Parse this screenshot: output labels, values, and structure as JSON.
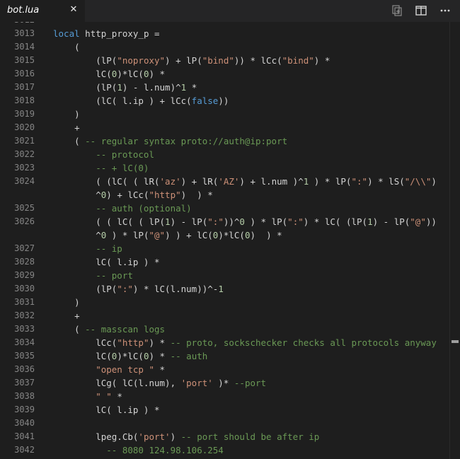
{
  "tab": {
    "title": "bot.lua",
    "close": "✕"
  },
  "actions": [
    "open-changes-icon",
    "split-editor-icon",
    "more-actions-icon"
  ],
  "lines": [
    {
      "n": "3012",
      "tokens": []
    },
    {
      "n": "3013",
      "tokens": [
        [
          "kw",
          "local"
        ],
        [
          "id",
          " http_proxy_p ="
        ]
      ]
    },
    {
      "n": "3014",
      "tokens": [
        [
          "id",
          "    ("
        ]
      ]
    },
    {
      "n": "3015",
      "tokens": [
        [
          "id",
          "        (lP("
        ],
        [
          "str",
          "\"noproxy\""
        ],
        [
          "id",
          ") + lP("
        ],
        [
          "str",
          "\"bind\""
        ],
        [
          "id",
          ")) * lCc("
        ],
        [
          "str",
          "\"bind\""
        ],
        [
          "id",
          ") *"
        ]
      ]
    },
    {
      "n": "3016",
      "tokens": [
        [
          "id",
          "        lC("
        ],
        [
          "num",
          "0"
        ],
        [
          "id",
          ")*lC("
        ],
        [
          "num",
          "0"
        ],
        [
          "id",
          ") *"
        ]
      ]
    },
    {
      "n": "3017",
      "tokens": [
        [
          "id",
          "        (lP("
        ],
        [
          "num",
          "1"
        ],
        [
          "id",
          ") - l.num)^"
        ],
        [
          "num",
          "1"
        ],
        [
          "id",
          " *"
        ]
      ]
    },
    {
      "n": "3018",
      "tokens": [
        [
          "id",
          "        (lC( l.ip ) + lCc("
        ],
        [
          "bool",
          "false"
        ],
        [
          "id",
          "))"
        ]
      ]
    },
    {
      "n": "3019",
      "tokens": [
        [
          "id",
          "    )"
        ]
      ]
    },
    {
      "n": "3020",
      "tokens": [
        [
          "id",
          "    +"
        ]
      ]
    },
    {
      "n": "3021",
      "tokens": [
        [
          "id",
          "    ( "
        ],
        [
          "cmt",
          "-- regular syntax proto://auth@ip:port"
        ]
      ]
    },
    {
      "n": "3022",
      "tokens": [
        [
          "cmt",
          "        -- protocol"
        ]
      ]
    },
    {
      "n": "3023",
      "tokens": [
        [
          "cmt",
          "        -- + lC(0)"
        ]
      ]
    },
    {
      "n": "3024",
      "tokens": [
        [
          "id",
          "        ( (lC( ( lR("
        ],
        [
          "str",
          "'az'"
        ],
        [
          "id",
          ") + lR("
        ],
        [
          "str",
          "'AZ'"
        ],
        [
          "id",
          ") + l.num )^"
        ],
        [
          "num",
          "1"
        ],
        [
          "id",
          " ) * lP("
        ],
        [
          "str",
          "\":\""
        ],
        [
          "id",
          ") * lS("
        ],
        [
          "str",
          "\"/\\\\\""
        ],
        [
          "id",
          ")"
        ]
      ]
    },
    {
      "n": "",
      "tokens": [
        [
          "id",
          "        ^"
        ],
        [
          "num",
          "0"
        ],
        [
          "id",
          ") + lCc("
        ],
        [
          "str",
          "\"http\""
        ],
        [
          "id",
          ")  ) *"
        ]
      ]
    },
    {
      "n": "3025",
      "tokens": [
        [
          "cmt",
          "        -- auth (optional)"
        ]
      ]
    },
    {
      "n": "3026",
      "tokens": [
        [
          "id",
          "        ( ( lC( ( lP("
        ],
        [
          "num",
          "1"
        ],
        [
          "id",
          ") - lP("
        ],
        [
          "str",
          "\":\""
        ],
        [
          "id",
          "))^"
        ],
        [
          "num",
          "0"
        ],
        [
          "id",
          " ) * lP("
        ],
        [
          "str",
          "\":\""
        ],
        [
          "id",
          ") * lC( (lP("
        ],
        [
          "num",
          "1"
        ],
        [
          "id",
          ") - lP("
        ],
        [
          "str",
          "\"@\""
        ],
        [
          "id",
          "))"
        ]
      ]
    },
    {
      "n": "",
      "tokens": [
        [
          "id",
          "        ^"
        ],
        [
          "num",
          "0"
        ],
        [
          "id",
          " ) * lP("
        ],
        [
          "str",
          "\"@\""
        ],
        [
          "id",
          ") ) + lC("
        ],
        [
          "num",
          "0"
        ],
        [
          "id",
          ")*lC("
        ],
        [
          "num",
          "0"
        ],
        [
          "id",
          ")  ) *"
        ]
      ]
    },
    {
      "n": "3027",
      "tokens": [
        [
          "cmt",
          "        -- ip"
        ]
      ]
    },
    {
      "n": "3028",
      "tokens": [
        [
          "id",
          "        lC( l.ip ) *"
        ]
      ]
    },
    {
      "n": "3029",
      "tokens": [
        [
          "cmt",
          "        -- port"
        ]
      ]
    },
    {
      "n": "3030",
      "tokens": [
        [
          "id",
          "        (lP("
        ],
        [
          "str",
          "\":\""
        ],
        [
          "id",
          ") * lC(l.num))^-"
        ],
        [
          "num",
          "1"
        ]
      ]
    },
    {
      "n": "3031",
      "tokens": [
        [
          "id",
          "    )"
        ]
      ]
    },
    {
      "n": "3032",
      "tokens": [
        [
          "id",
          "    +"
        ]
      ]
    },
    {
      "n": "3033",
      "tokens": [
        [
          "id",
          "    ( "
        ],
        [
          "cmt",
          "-- masscan logs"
        ]
      ]
    },
    {
      "n": "3034",
      "tokens": [
        [
          "id",
          "        lCc("
        ],
        [
          "str",
          "\"http\""
        ],
        [
          "id",
          ") * "
        ],
        [
          "cmt",
          "-- proto, sockschecker checks all protocols anyway"
        ]
      ]
    },
    {
      "n": "3035",
      "tokens": [
        [
          "id",
          "        lC("
        ],
        [
          "num",
          "0"
        ],
        [
          "id",
          ")*lC("
        ],
        [
          "num",
          "0"
        ],
        [
          "id",
          ") * "
        ],
        [
          "cmt",
          "-- auth"
        ]
      ]
    },
    {
      "n": "3036",
      "tokens": [
        [
          "str",
          "        \"open tcp \""
        ],
        [
          "id",
          " *"
        ]
      ]
    },
    {
      "n": "3037",
      "tokens": [
        [
          "id",
          "        lCg( lC(l.num), "
        ],
        [
          "str",
          "'port'"
        ],
        [
          "id",
          " )* "
        ],
        [
          "cmt",
          "--port"
        ]
      ]
    },
    {
      "n": "3038",
      "tokens": [
        [
          "str",
          "        \" \""
        ],
        [
          "id",
          " *"
        ]
      ]
    },
    {
      "n": "3039",
      "tokens": [
        [
          "id",
          "        lC( l.ip ) *"
        ]
      ]
    },
    {
      "n": "3040",
      "tokens": []
    },
    {
      "n": "3041",
      "tokens": [
        [
          "id",
          "        lpeg.Cb("
        ],
        [
          "str",
          "'port'"
        ],
        [
          "id",
          ") "
        ],
        [
          "cmt",
          "-- port should be after ip"
        ]
      ]
    },
    {
      "n": "3042",
      "tokens": [
        [
          "cmt",
          "          -- 8080 124.98.106.254"
        ]
      ]
    }
  ],
  "colors": {
    "background": "#1e1e1e",
    "keyword": "#569cd6",
    "string": "#ce9178",
    "number": "#b5cea8",
    "comment": "#6a9955",
    "text": "#d4d4d4",
    "line_number": "#858585"
  }
}
